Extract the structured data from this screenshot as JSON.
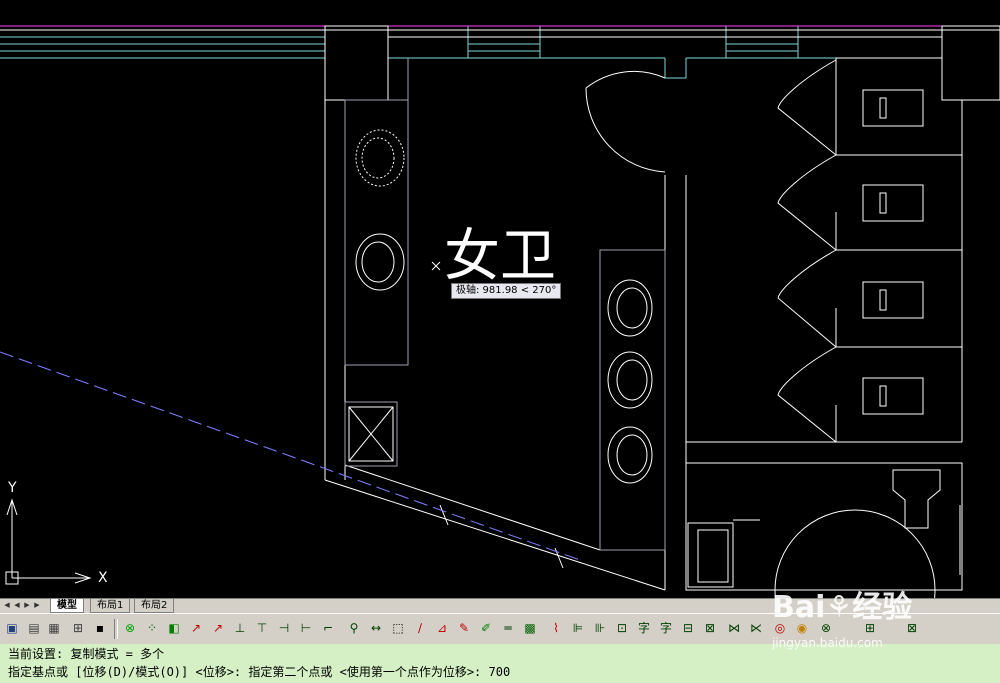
{
  "canvas": {
    "room_label": "女卫",
    "axis_y": "Y",
    "axis_x": "X"
  },
  "tooltip": {
    "text": "极轴: 981.98 < 270°"
  },
  "tabs": {
    "items": [
      {
        "label": "模型",
        "active": true
      },
      {
        "label": "布局1",
        "active": false
      },
      {
        "label": "布局2",
        "active": false
      }
    ]
  },
  "toolbar": {
    "icons": [
      "save-icon",
      "layer-icon",
      "properties-icon",
      "match-icon",
      "floppy-icon",
      "osnap-icon",
      "grip-icon",
      "block-icon",
      "snap-icon",
      "snap2-icon",
      "trim-icon",
      "extend-icon",
      "break-icon",
      "chamfer-icon",
      "fillet-icon",
      "zoom-icon",
      "dist-icon",
      "rect-icon",
      "line-icon",
      "edit-icon",
      "pen-icon",
      "pline-icon",
      "hatch-icon",
      "text-icon",
      "dim-icon",
      "dim2-icon",
      "table-icon",
      "image-icon",
      "symbol-icon",
      "text-style-icon",
      "mtext-icon",
      "insert-icon",
      "xref-icon",
      "copy-icon",
      "attrib-icon",
      "field-icon",
      "color-icon",
      "plot-icon",
      "help-icon"
    ]
  },
  "command": {
    "line1": "当前设置:  复制模式 = 多个",
    "line2": "指定基点或 [位移(D)/模式(O)] <位移>: 指定第二个点或 <使用第一个点作为位移>: 700"
  },
  "watermark": {
    "logo": "Bai⚘经验",
    "url": "jingyan.baidu.com"
  },
  "colors": {
    "canvas_bg": "#000000",
    "line_white": "#ffffff",
    "line_cyan": "#7fd8d8",
    "line_magenta": "#ff40ff",
    "line_gray": "#a0a0b0",
    "cmd_bg": "#d4f0c4",
    "ui_bg": "#d4d0c8"
  }
}
